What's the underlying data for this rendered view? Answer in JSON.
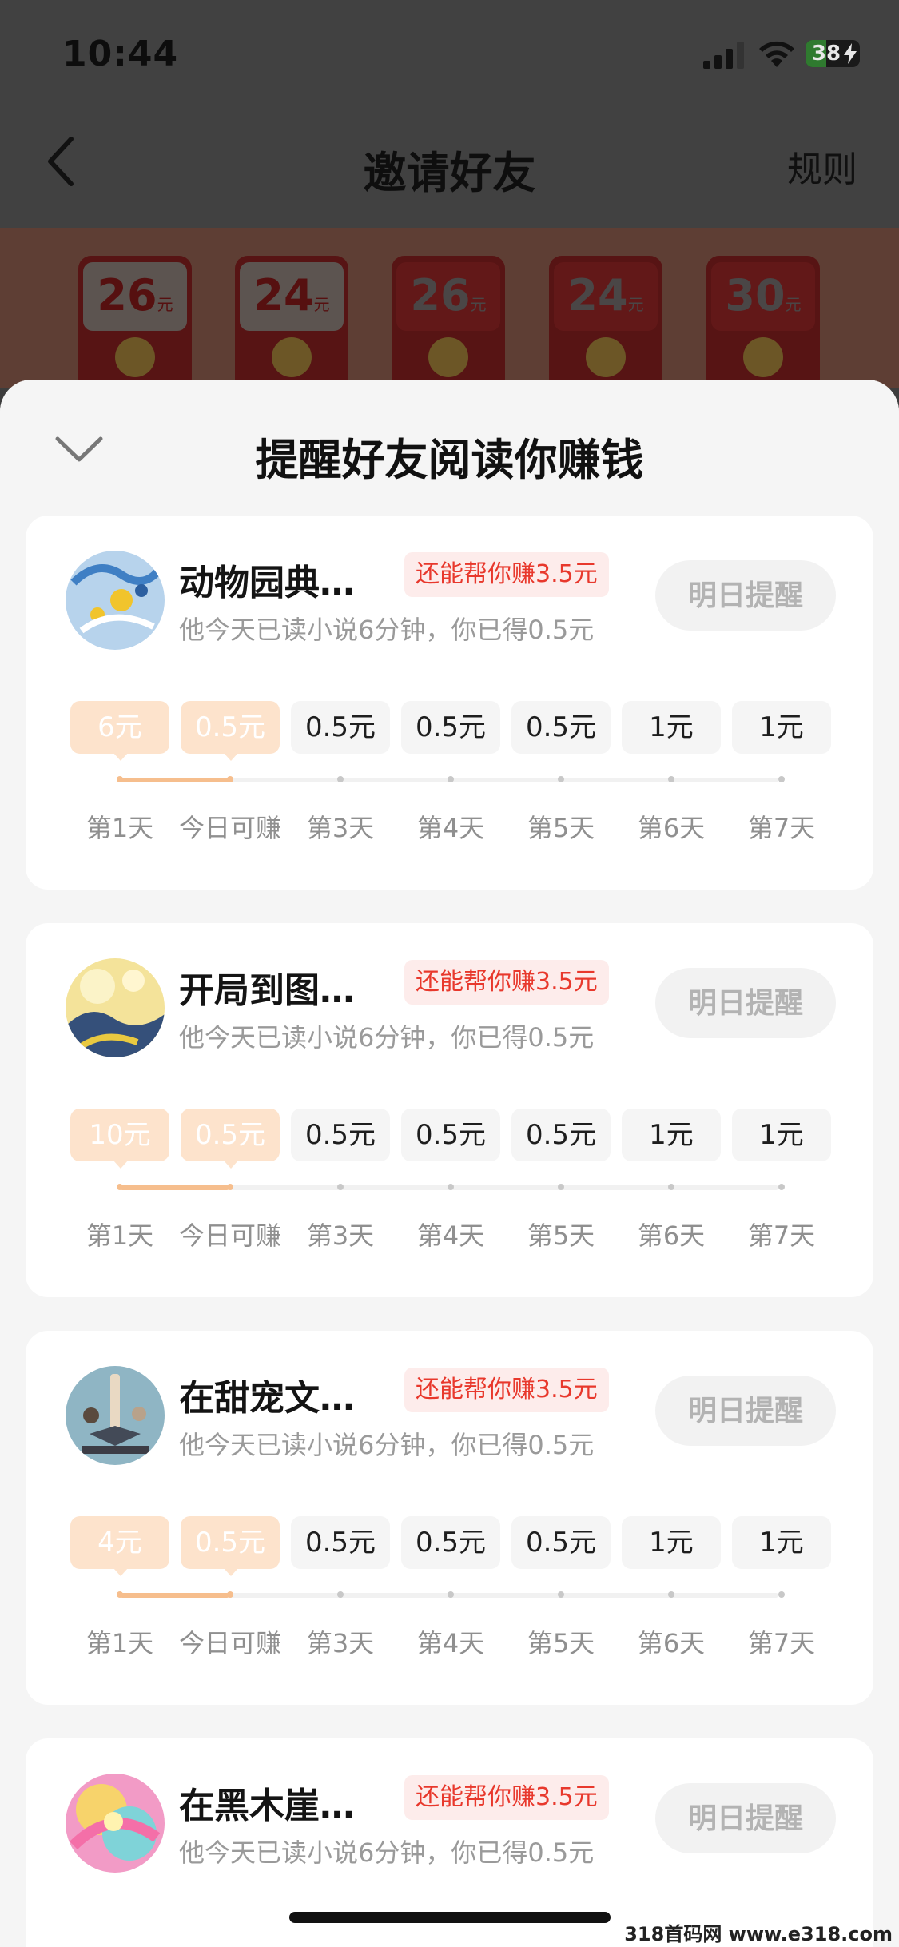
{
  "status_bar": {
    "time": "10:44",
    "battery": "38",
    "battery_level": 0.38
  },
  "nav": {
    "title": "邀请好友",
    "rules": "规则"
  },
  "envelopes": [
    {
      "amount": "26",
      "unit": "元"
    },
    {
      "amount": "24",
      "unit": "元"
    },
    {
      "amount": "26",
      "unit": "元"
    },
    {
      "amount": "24",
      "unit": "元"
    },
    {
      "amount": "30",
      "unit": "元"
    }
  ],
  "sheet": {
    "title": "提醒好友阅读你赚钱"
  },
  "friends": [
    {
      "name": "动物园典…",
      "badge": "还能帮你赚3.5元",
      "status": "他今天已读小说6分钟，你已得0.5元",
      "button": "明日提醒",
      "amounts": [
        "6元",
        "0.5元",
        "0.5元",
        "0.5元",
        "0.5元",
        "1元",
        "1元"
      ],
      "days": [
        "第1天",
        "今日可赚",
        "第3天",
        "第4天",
        "第5天",
        "第6天",
        "第7天"
      ],
      "completed": 2
    },
    {
      "name": "开局到图…",
      "badge": "还能帮你赚3.5元",
      "status": "他今天已读小说6分钟，你已得0.5元",
      "button": "明日提醒",
      "amounts": [
        "10元",
        "0.5元",
        "0.5元",
        "0.5元",
        "0.5元",
        "1元",
        "1元"
      ],
      "days": [
        "第1天",
        "今日可赚",
        "第3天",
        "第4天",
        "第5天",
        "第6天",
        "第7天"
      ],
      "completed": 2
    },
    {
      "name": "在甜宠文…",
      "badge": "还能帮你赚3.5元",
      "status": "他今天已读小说6分钟，你已得0.5元",
      "button": "明日提醒",
      "amounts": [
        "4元",
        "0.5元",
        "0.5元",
        "0.5元",
        "0.5元",
        "1元",
        "1元"
      ],
      "days": [
        "第1天",
        "今日可赚",
        "第3天",
        "第4天",
        "第5天",
        "第6天",
        "第7天"
      ],
      "completed": 2
    },
    {
      "name": "在黑木崖…",
      "badge": "还能帮你赚3.5元",
      "status": "他今天已读小说6分钟，你已得0.5元",
      "button": "明日提醒",
      "amounts": [],
      "days": [],
      "completed": 0
    }
  ],
  "watermark": "318首码网 www.e318.com"
}
